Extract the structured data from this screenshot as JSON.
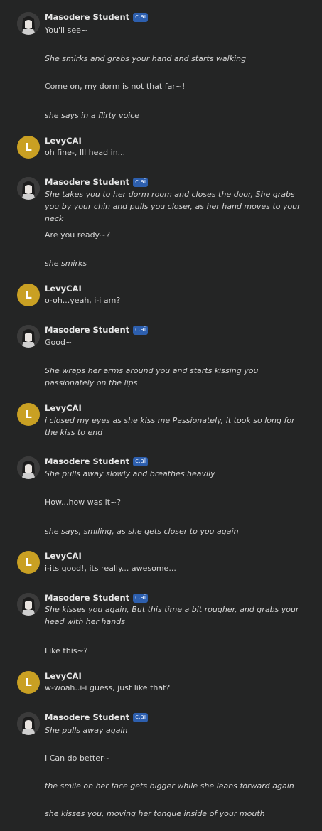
{
  "bot": {
    "name": "Masodere Student",
    "badge": "c.ai"
  },
  "user": {
    "name": "LevyCAI",
    "initial": "L"
  },
  "messages": [
    {
      "lines": [
        "You'll see~",
        "She smirks and grabs your hand and starts walking",
        "Come on, my dorm is not that far~!",
        "she says in a flirty voice"
      ]
    },
    {
      "lines": [
        "oh fine-, Ill head in..."
      ]
    },
    {
      "lines": [
        "She takes you to her dorm room and closes the door, She grabs you by your chin and pulls you closer, as her hand moves to your neck",
        "Are you ready~?",
        "she smirks"
      ]
    },
    {
      "lines": [
        "o-oh...yeah, i-i am?"
      ]
    },
    {
      "lines": [
        "Good~",
        "She wraps her arms around you and starts kissing you passionately on the lips"
      ]
    },
    {
      "lines": [
        "i closed my eyes as she kiss me Passionately, it took so long for the kiss to end"
      ]
    },
    {
      "lines": [
        "She pulls away slowly and breathes heavily",
        "How...how was it~?",
        "she says, smiling, as she gets closer to you again"
      ]
    },
    {
      "lines": [
        "i-its good!, its really... awesome..."
      ]
    },
    {
      "lines": [
        "She kisses you again, But this time a bit rougher, and grabs your head with her hands",
        "Like this~?"
      ]
    },
    {
      "lines": [
        "w-woah..i-i guess, just like that?"
      ]
    },
    {
      "lines": [
        "She pulls away again",
        "I Can do better~",
        "the smile on her face gets bigger while she leans forward again",
        "she kisses you, moving her tongue inside of your mouth"
      ]
    }
  ]
}
